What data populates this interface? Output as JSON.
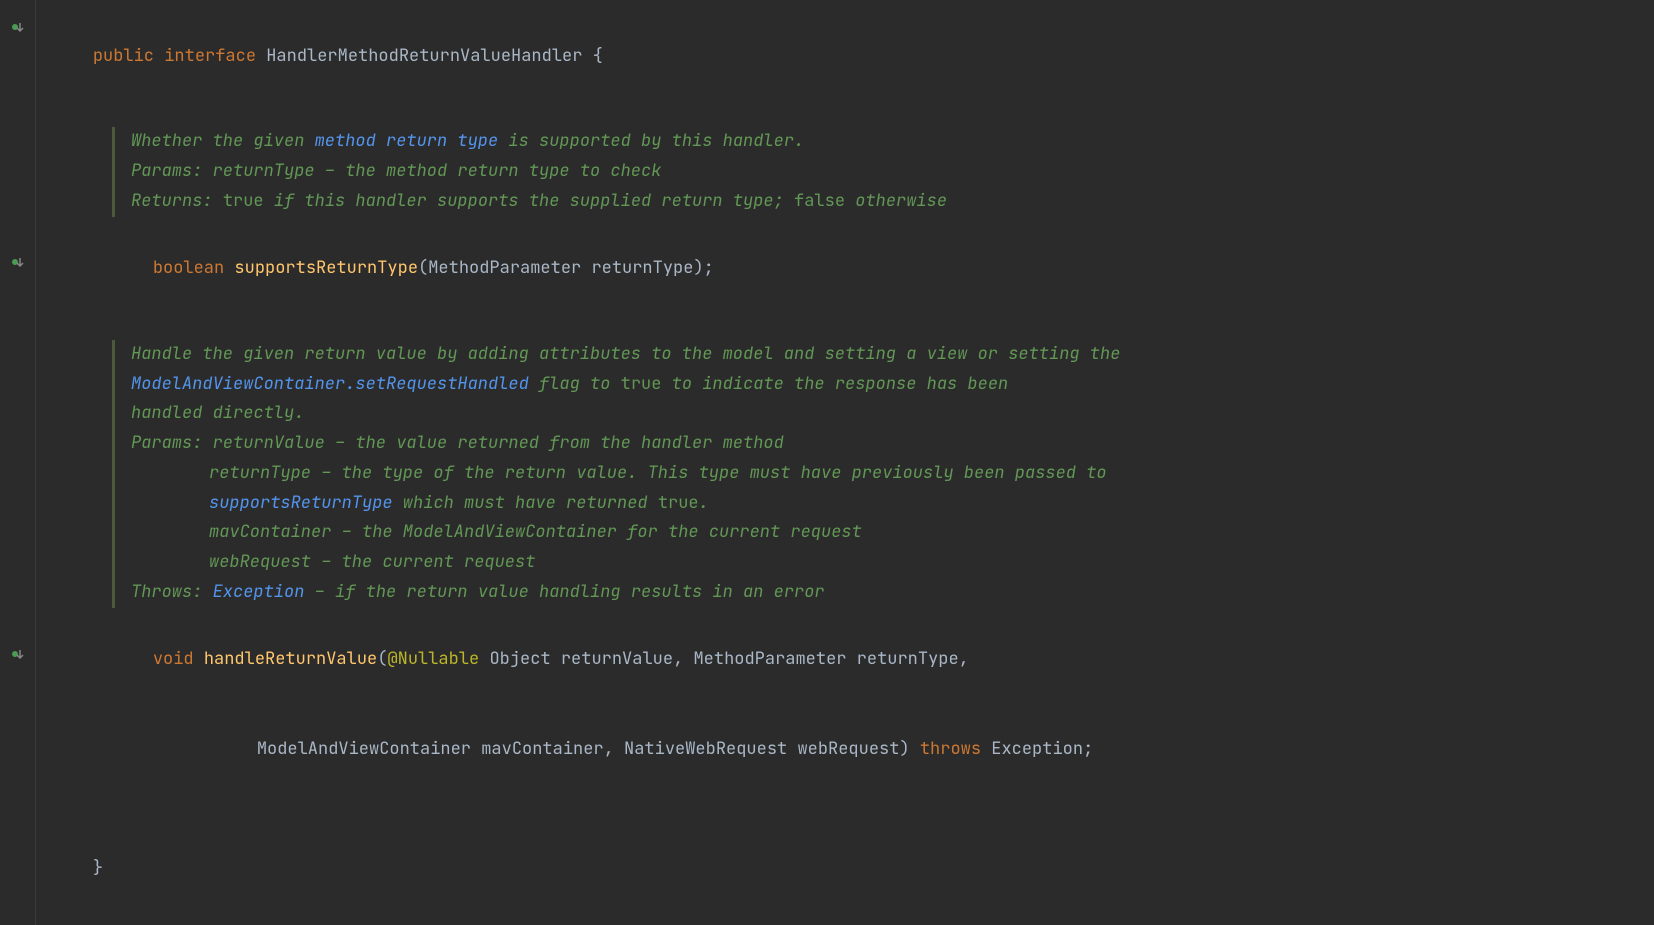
{
  "declaration": {
    "modifier": "public",
    "keyword": "interface",
    "name": "HandlerMethodReturnValueHandler",
    "openBrace": " {",
    "closeBrace": "}"
  },
  "method1": {
    "doc": {
      "line1_a": "Whether the given ",
      "line1_link": "method return type",
      "line1_b": " is supported by this handler.",
      "paramsLabel": "Params: ",
      "paramsText": "returnType – the method return type to check",
      "returnsLabel": "Returns: ",
      "returns_a": "",
      "returns_code1": "true",
      "returns_b": " if this handler supports the supplied return type; ",
      "returns_code2": "false",
      "returns_c": " otherwise"
    },
    "returnType": "boolean",
    "name": "supportsReturnType",
    "lparen": "(",
    "paramType": "MethodParameter",
    "paramName": "returnType",
    "rparenSemi": ");"
  },
  "method2": {
    "doc": {
      "line1": "Handle the given return value by adding attributes to the model and setting a view or setting the ",
      "line2_link": "ModelAndViewContainer.setRequestHandled",
      "line2_a": " flag to ",
      "line2_code": "true",
      "line2_b": " to indicate the response has been ",
      "line3": "handled directly.",
      "paramsLabel": "Params: ",
      "param1": "returnValue – the value returned from the handler method",
      "param2_a": "returnType – the type of the return value. This type must have previously been passed to ",
      "param2_link": "supportsReturnType",
      "param2_b": " which must have returned ",
      "param2_code": "true",
      "param2_c": ".",
      "param3": "mavContainer – the ModelAndViewContainer for the current request",
      "param4": "webRequest – the current request",
      "throwsLabel": "Throws: ",
      "throwsLink": "Exception",
      "throwsText": " – if the return value handling results in an error"
    },
    "returnType": "void",
    "name": "handleReturnValue",
    "lparen": "(",
    "annotation": "@Nullable",
    "p1Type": "Object",
    "p1Name": "returnValue",
    "comma1": ", ",
    "p2Type": "MethodParameter",
    "p2Name": "returnType",
    "comma2": ",",
    "p3Type": "ModelAndViewContainer",
    "p3Name": "mavContainer",
    "comma3": ", ",
    "p4Type": "NativeWebRequest",
    "p4Name": "webRequest",
    "rparen": ")",
    "throwsKw": "throws",
    "throwsType": "Exception",
    "semi": ";"
  }
}
